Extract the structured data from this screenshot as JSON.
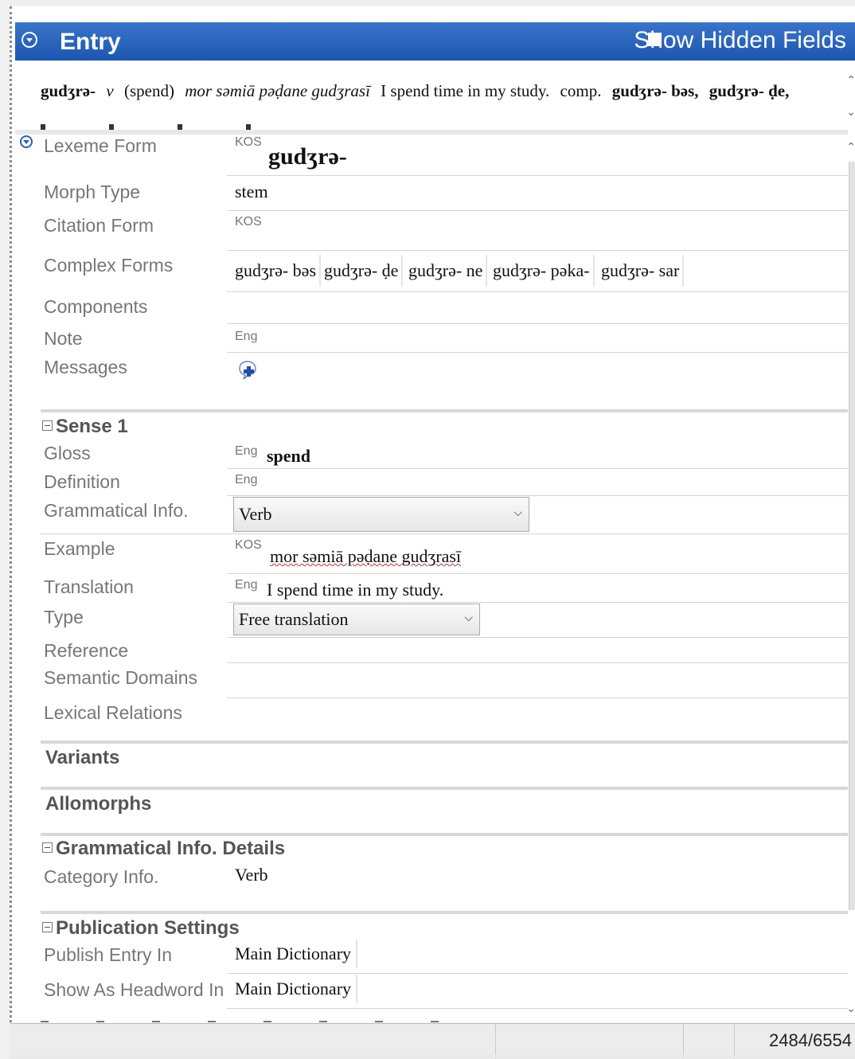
{
  "header": {
    "title": "Entry",
    "show_hidden_label": "Show Hidden Fields"
  },
  "preview": {
    "headword": "gudʒrə-",
    "pos": "v",
    "gloss": "(spend)",
    "example": "mor səmiā pəḍane gudʒrasī",
    "translation": "I spend time in my study.",
    "comp_label": "comp.",
    "comp1": "gudʒrə- bəs,",
    "comp2": "gudʒrə- ḍe,"
  },
  "fields": {
    "lexeme_form": {
      "label": "Lexeme Form",
      "ws": "KOS",
      "value": "gudʒrə-"
    },
    "morph_type": {
      "label": "Morph Type",
      "value": "stem"
    },
    "citation_form": {
      "label": "Citation Form",
      "ws": "KOS"
    },
    "complex_forms": {
      "label": "Complex Forms",
      "items": [
        "gudʒrə- bəs",
        "gudʒrə- ḍe",
        "gudʒrə- ne",
        "gudʒrə- pəka-",
        "gudʒrə- sar"
      ]
    },
    "components": {
      "label": "Components"
    },
    "note": {
      "label": "Note",
      "ws": "Eng"
    },
    "messages": {
      "label": "Messages"
    }
  },
  "sense": {
    "title": "Sense 1",
    "gloss": {
      "label": "Gloss",
      "ws": "Eng",
      "value": "spend"
    },
    "definition": {
      "label": "Definition",
      "ws": "Eng"
    },
    "gram_info": {
      "label": "Grammatical Info.",
      "value": "Verb"
    },
    "example": {
      "label": "Example",
      "ws": "KOS",
      "value": "mor səmiā pəḍane gudʒrasī"
    },
    "translation": {
      "label": "Translation",
      "ws": "Eng",
      "value": "I spend time in my study."
    },
    "type": {
      "label": "Type",
      "value": "Free translation"
    },
    "reference": {
      "label": "Reference"
    },
    "semantic_domains": {
      "label": "Semantic Domains"
    },
    "lexical_relations": {
      "label": "Lexical Relations"
    }
  },
  "variants": {
    "title": "Variants"
  },
  "allomorphs": {
    "title": "Allomorphs"
  },
  "gram_details": {
    "title": "Grammatical Info. Details",
    "category": {
      "label": "Category Info.",
      "value": "Verb"
    }
  },
  "publication": {
    "title": "Publication Settings",
    "publish_in": {
      "label": "Publish Entry In",
      "value": "Main Dictionary"
    },
    "headword_in": {
      "label": "Show As Headword In",
      "value": "Main Dictionary"
    }
  },
  "status": {
    "record_count": "2484/6554"
  }
}
